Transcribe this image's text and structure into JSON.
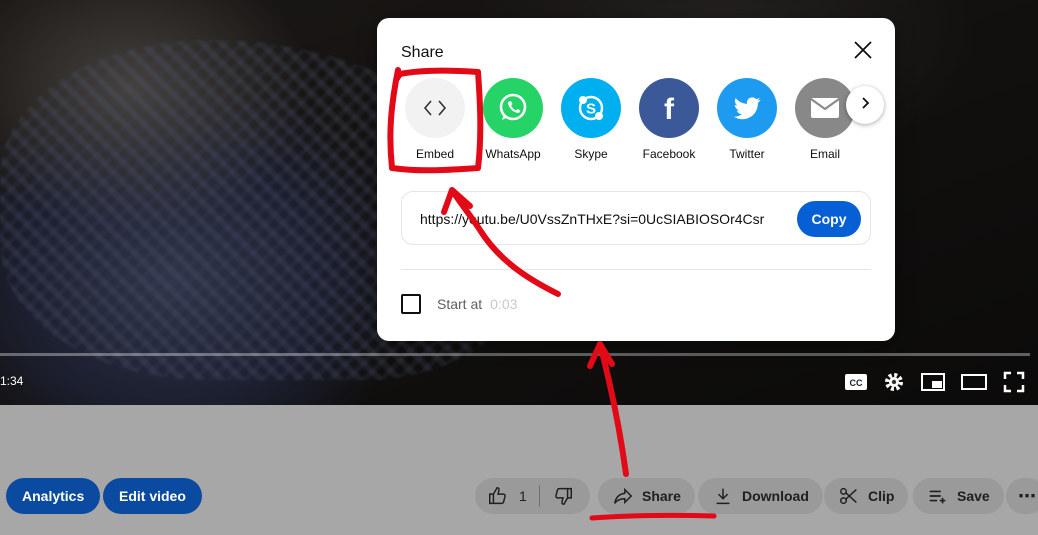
{
  "player": {
    "time": "1:34",
    "icons": [
      "closed-captions-icon",
      "settings-icon",
      "miniplayer-icon",
      "theater-mode-icon",
      "fullscreen-icon"
    ]
  },
  "actions": {
    "analytics": "Analytics",
    "edit_video": "Edit video",
    "like_count": "1",
    "share": "Share",
    "download": "Download",
    "clip": "Clip",
    "save": "Save",
    "more": "⋯"
  },
  "dialog": {
    "title": "Share",
    "targets": [
      {
        "id": "embed",
        "label": "Embed",
        "color": "#f2f2f2"
      },
      {
        "id": "whatsapp",
        "label": "WhatsApp",
        "color": "#25d366"
      },
      {
        "id": "skype",
        "label": "Skype",
        "color": "#00aff0"
      },
      {
        "id": "facebook",
        "label": "Facebook",
        "color": "#3b5998"
      },
      {
        "id": "twitter",
        "label": "Twitter",
        "color": "#1d9bf0"
      },
      {
        "id": "email",
        "label": "Email",
        "color": "#888888"
      }
    ],
    "url": "https://youtu.be/U0VssZnTHxE?si=0UcSIABIOSOr4Csr",
    "copy_label": "Copy",
    "start_at_label": "Start at",
    "start_at_value": "0:03",
    "start_at_checked": false
  },
  "colors": {
    "copy_button": "#065fd4",
    "action_blue": "#0a4aa0",
    "annotation_red": "#e30a17"
  }
}
